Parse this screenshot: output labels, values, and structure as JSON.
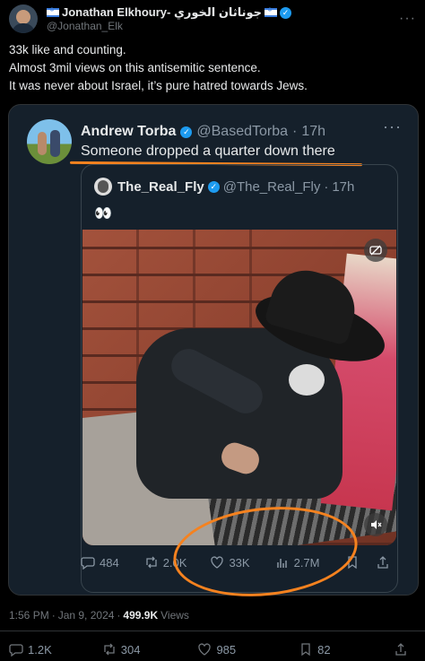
{
  "outer": {
    "display_name": "Jonathan Elkhoury- جوناثان الخوري",
    "handle": "@Jonathan_Elk",
    "more": "···",
    "text_lines": [
      "33k like and counting.",
      "Almost 3mil views on this antisemitic sentence.",
      "It was never about Israel, it’s pure hatred towards Jews."
    ]
  },
  "quote": {
    "name": "Andrew Torba",
    "handle": "@BasedTorba",
    "separator": "·",
    "time": "17h",
    "text": "Someone dropped a quarter down there",
    "more": "···",
    "inner": {
      "name": "The_Real_Fly",
      "handle": "@The_Real_Fly",
      "separator": "·",
      "time": "17h",
      "text": "👀"
    },
    "actions": {
      "replies": "484",
      "reposts": "2.0K",
      "likes": "33K",
      "views": "2.7M"
    }
  },
  "meta": {
    "time": "1:56 PM",
    "date": "Jan 9, 2024",
    "separator": "·",
    "views_count": "499.9K",
    "views_label": "Views"
  },
  "bottom_actions": {
    "replies": "1.2K",
    "reposts": "304",
    "likes": "985",
    "bookmarks": "82"
  },
  "colors": {
    "background": "#000000",
    "card": "#15202b",
    "accent_blue": "#1d9bf0",
    "annotation_orange": "#f5821f"
  }
}
